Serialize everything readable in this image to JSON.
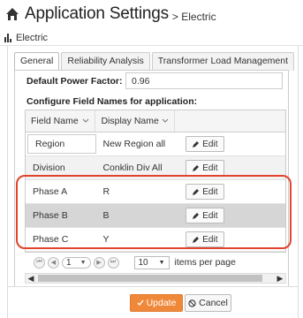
{
  "header": {
    "title": "Application Settings",
    "breadcrumb": "> Electric",
    "icon": "home-icon"
  },
  "section": {
    "label": "Electric",
    "icon": "bar-chart-icon"
  },
  "tabs": [
    {
      "label": "General",
      "active": true
    },
    {
      "label": "Reliability Analysis",
      "active": false
    },
    {
      "label": "Transformer Load Management",
      "active": false
    }
  ],
  "power_factor": {
    "label": "Default Power Factor:",
    "value": "0.96"
  },
  "config_label": "Configure Field Names for application:",
  "grid": {
    "columns": [
      "Field Name",
      "Display Name",
      ""
    ],
    "rows": [
      {
        "field": "Region",
        "display": "New Region all",
        "action": "Edit"
      },
      {
        "field": "Division",
        "display": "Conklin Div All",
        "action": "Edit"
      },
      {
        "field": "Phase A",
        "display": "R",
        "action": "Edit"
      },
      {
        "field": "Phase B",
        "display": "B",
        "action": "Edit"
      },
      {
        "field": "Phase C",
        "display": "Y",
        "action": "Edit"
      }
    ]
  },
  "pager": {
    "current_page": "1",
    "page_size": "10",
    "items_per_page_label": "items per page"
  },
  "buttons": {
    "update": "Update",
    "cancel": "Cancel"
  },
  "colors": {
    "accent": "#f0883a",
    "highlight": "#e2432d"
  }
}
